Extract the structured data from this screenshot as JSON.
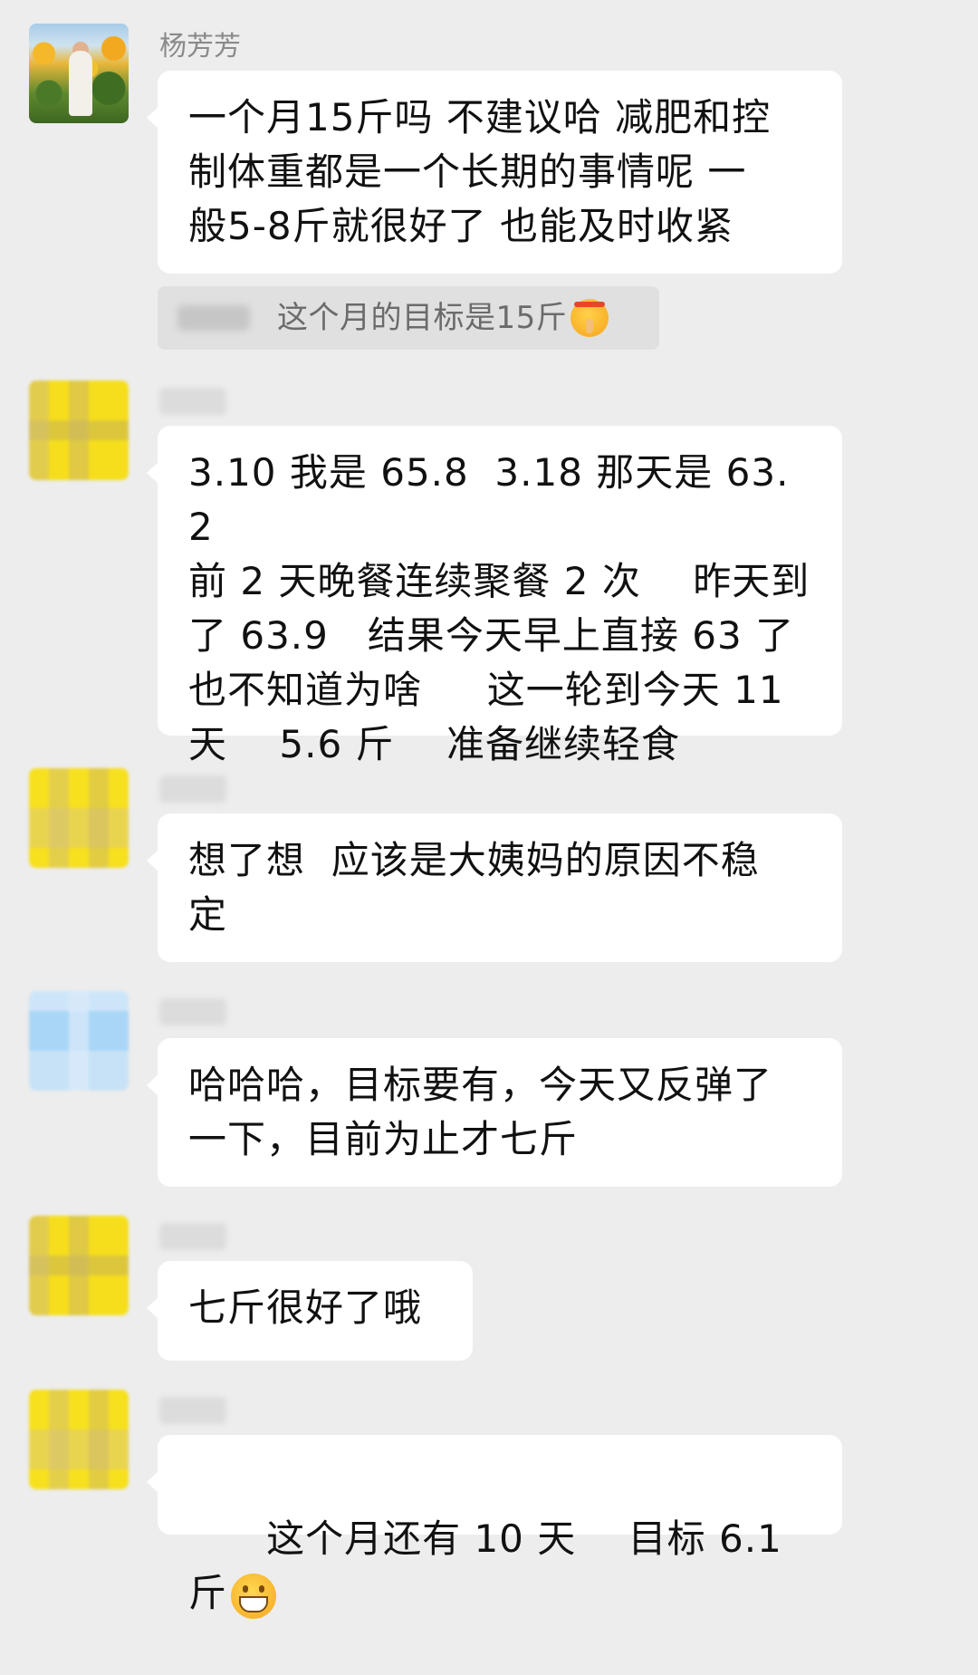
{
  "messages": [
    {
      "sender": "杨芳芳",
      "avatar": "sunflower-photo",
      "text": "一个月15斤吗 不建议哈 减肥和控\n制体重都是一个长期的事情呢 一\n般5-8斤就很好了 也能及时收紧"
    },
    {
      "sender": "",
      "avatar": "yellow-avatar",
      "text": "3.10 我是 65.8  3.18 那天是 63.2\n前 2 天晚餐连续聚餐 2 次    昨天到\n了 63.9   结果今天早上直接 63 了\n也不知道为啥     这一轮到今天 11\n天    5.6 斤    准备继续轻食"
    },
    {
      "sender": "",
      "avatar": "yellow-avatar",
      "text": "想了想  应该是大姨妈的原因不稳\n定"
    },
    {
      "sender": "",
      "avatar": "blue-avatar",
      "text": "哈哈哈，目标要有，今天又反弹了\n一下，目前为止才七斤"
    },
    {
      "sender": "",
      "avatar": "yellow-avatar",
      "text": "七斤很好了哦"
    },
    {
      "sender": "",
      "avatar": "yellow-avatar",
      "text": "这个月还有 10 天    目标 6.1 斤"
    }
  ],
  "quote": {
    "text": "这个月的目标是15斤",
    "emoji": "shushing-face-emoji"
  },
  "emoji_last": "grinning-face-emoji",
  "colors": {
    "background": "#ededed",
    "bubble": "#ffffff",
    "quote_bg": "#e0e0e0",
    "sender_text": "#8a8a8a"
  }
}
